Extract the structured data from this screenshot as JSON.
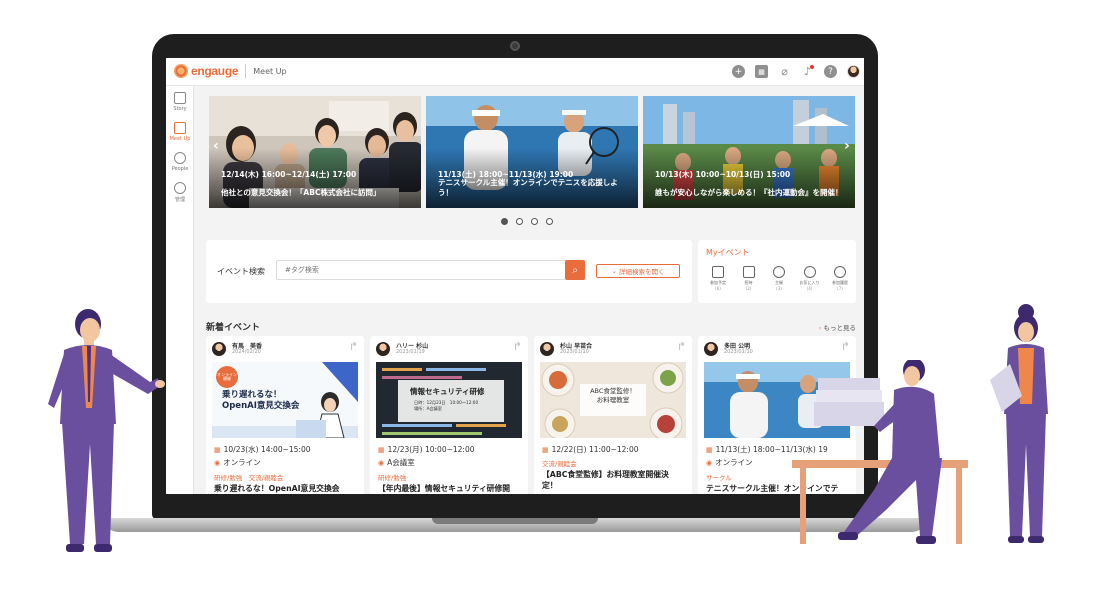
{
  "header": {
    "brand": "engauge",
    "app_name": "Meet Up"
  },
  "sidebar": {
    "items": [
      {
        "label": "Story",
        "icon": "story-icon"
      },
      {
        "label": "Meet Up",
        "icon": "calendar-check-icon",
        "active": true
      },
      {
        "label": "People",
        "icon": "people-icon"
      },
      {
        "label": "管理",
        "icon": "gear-icon"
      }
    ]
  },
  "carousel": {
    "slides": [
      {
        "date": "12/14(木) 16:00~12/14(土) 17:00",
        "title": "他社との意見交換会！「ABC株式会社に訪問」"
      },
      {
        "date": "11/13(土) 18:00~11/13(水) 19:00",
        "title": "テニスサークル主催！オンラインでテニスを応援しよう！"
      },
      {
        "date": "10/13(木) 10:00~10/13(日) 15:00",
        "title": "誰もが安心しながら楽しめる！『社内運動会』を開催！"
      }
    ],
    "prev": "‹",
    "next": "›",
    "active_dot": 0
  },
  "search": {
    "label": "イベント検索",
    "placeholder": "#タグ検索",
    "advanced_label": "詳細検索を開く"
  },
  "my_events": {
    "title": "Myイベント",
    "items": [
      {
        "label": "参加予定",
        "count": "(6)"
      },
      {
        "label": "招待",
        "count": "(2)"
      },
      {
        "label": "主催",
        "count": "(3)"
      },
      {
        "label": "お気に入り",
        "count": "(4)"
      },
      {
        "label": "参加履歴",
        "count": "(7)"
      }
    ]
  },
  "new_events": {
    "heading": "新着イベント",
    "more": "もっと見る",
    "cards": [
      {
        "author": "有馬　美香",
        "posted": "2024/02/20",
        "image_title": "乗り遅れるな！\nOpenAI意見交換会",
        "badge": "オンライン開催",
        "when": "10/23(水) 14:00~15:00",
        "where": "オンライン",
        "tags": "研修/勉強　交流/親睦会",
        "title": "乗り遅れるな！OpenAI意見交換会"
      },
      {
        "author": "ハリー 杉山",
        "posted": "2023/01/19",
        "image_title": "情報セキュリティ研修",
        "image_sub": "日時：12月23日　10:00〜12:00\n場所：A会議室",
        "when": "12/23(月) 10:00~12:00",
        "where": "A会議室",
        "tags": "研修/勉強",
        "title": "【年内最後】情報セキュリティ研修開"
      },
      {
        "author": "杉山 早苗合",
        "posted": "2023/01/10",
        "image_title": "ABC食堂監修！\nお料理教室",
        "when": "12/22(日) 11:00~12:00",
        "where": "",
        "tags": "交流/親睦会",
        "title": "【ABC食堂監修】お料理教室開催決定！"
      },
      {
        "author": "多田 公明",
        "posted": "2023/01/10",
        "when": "11/13(土) 18:00~11/13(水) 19",
        "where": "オンライン",
        "tags": "サークル",
        "title": "テニスサークル主催！オンラインでテ"
      }
    ]
  },
  "colors": {
    "accent": "#e96d3c",
    "suit": "#6a4f9e",
    "shirt": "#f0874a"
  }
}
